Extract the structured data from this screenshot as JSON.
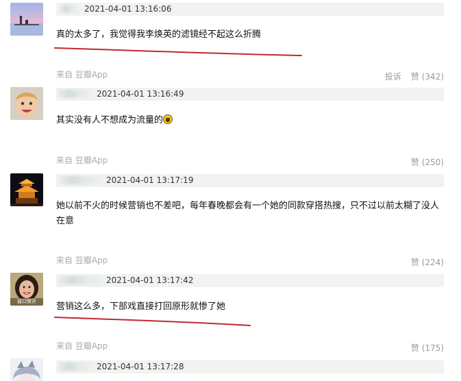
{
  "comments": [
    {
      "timestamp": "2021-04-01 13:16:06",
      "text": "真的太多了，我觉得我李焕英的滤镜经不起这么折腾",
      "source": "来自 豆瓣App",
      "report_label": "投诉",
      "like_label": "赞 (342)"
    },
    {
      "timestamp": "2021-04-01 13:16:49",
      "text": "其实没有人不想成为流量的",
      "emoji": "smiley-emoji",
      "source": "来自 豆瓣App",
      "like_label": "赞 (250)"
    },
    {
      "timestamp": "2021-04-01 13:17:19",
      "text": "她以前不火的时候营销也不差吧，每年春晚都会有一个她的同款穿搭热搜，只不过以前太糊了没人在意",
      "source": "来自 豆瓣App",
      "like_label": "赞 (224)"
    },
    {
      "timestamp": "2021-04-01 13:17:42",
      "avatar_caption": "窗口常开",
      "text": "营销这么多，下部戏直接打回原形就惨了她",
      "source": "来自 豆瓣App",
      "like_label": "赞 (175)"
    },
    {
      "timestamp": "2021-04-01 13:17:28"
    }
  ],
  "colors": {
    "meta_bar": "#f0f3ef",
    "underline": "#c0282e",
    "footer_text": "#aaaaaa"
  }
}
